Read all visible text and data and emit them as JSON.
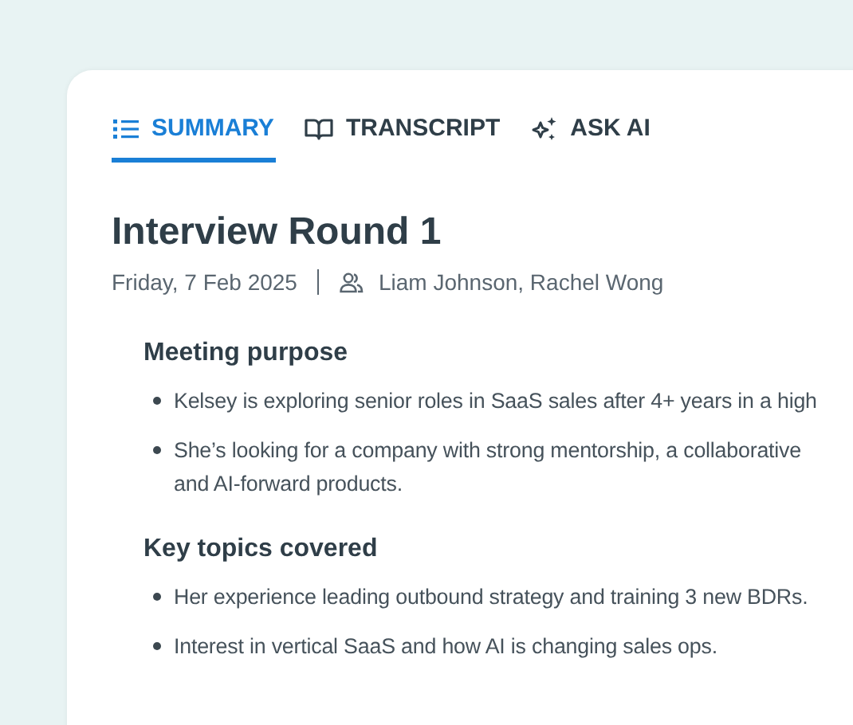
{
  "tabs": [
    {
      "label": "SUMMARY",
      "kind": "list",
      "selected": true
    },
    {
      "label": "TRANSCRIPT",
      "kind": "book",
      "selected": false
    },
    {
      "label": "ASK AI",
      "kind": "sparkle",
      "selected": false
    }
  ],
  "title": "Interview Round 1",
  "date": "Friday, 7 Feb 2025",
  "participants": "Liam Johnson, Rachel Wong",
  "sections": [
    {
      "heading": "Meeting purpose",
      "bullets": [
        {
          "lines": [
            "Kelsey is exploring senior roles in SaaS sales after 4+ years in a high"
          ]
        },
        {
          "lines": [
            "She’s looking for a company with strong mentorship, a collaborative",
            "and AI-forward products."
          ]
        }
      ]
    },
    {
      "heading": "Key topics covered",
      "bullets": [
        {
          "lines": [
            "Her experience leading outbound strategy and training 3 new BDRs."
          ]
        },
        {
          "lines": [
            "Interest in vertical SaaS and how AI is changing sales ops."
          ]
        }
      ]
    }
  ]
}
